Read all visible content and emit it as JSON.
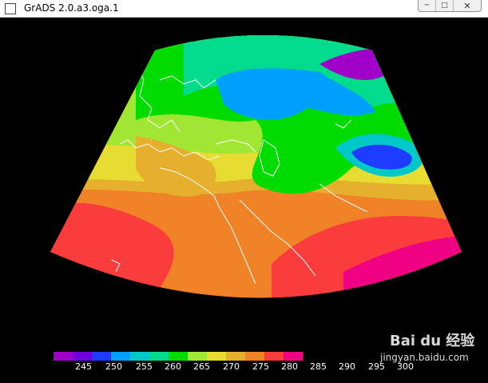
{
  "window": {
    "title": "GrADS 2.0.a3.oga.1",
    "minimize_icon": "minimize-icon",
    "maximize_icon": "maximize-icon",
    "close_icon": "close-icon"
  },
  "colorbar": {
    "colors": [
      "#a000c8",
      "#6e00dc",
      "#1e3cff",
      "#00a0ff",
      "#00c8c8",
      "#00dc8c",
      "#00dc00",
      "#a0e632",
      "#e6dc32",
      "#e6af2d",
      "#f08228",
      "#fa3c3c",
      "#f00082"
    ],
    "labels": [
      "245",
      "250",
      "255",
      "260",
      "265",
      "270",
      "275",
      "280",
      "285",
      "290",
      "295",
      "300"
    ]
  },
  "watermark": {
    "logo_text": "Bai du 经验",
    "url_text": "jingyan.baidu.com"
  }
}
